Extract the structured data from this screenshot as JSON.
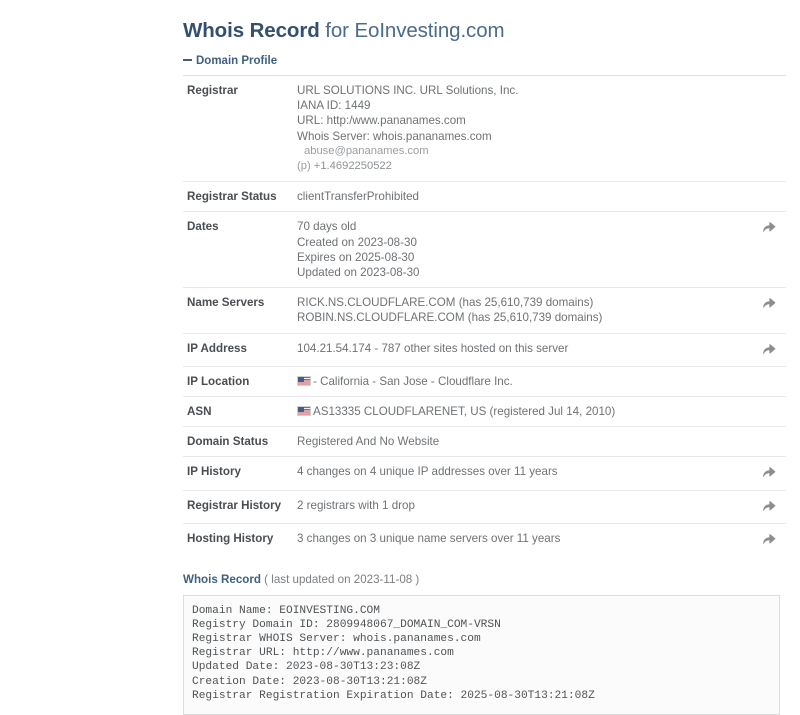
{
  "header": {
    "title_strong": "Whois Record",
    "title_rest": " for EoInvesting.com",
    "domain": "EoInvesting.com"
  },
  "section": {
    "toggle_label": "Domain Profile",
    "toggle_state": "expanded",
    "minus_glyph": "minus-icon"
  },
  "colors": {
    "title": "#34506e",
    "link": "#3f5f80",
    "label": "#4a4e52",
    "value": "#6e7275",
    "rule": "#e7e8ea",
    "box_border": "#dcdddf",
    "box_bg": "#fbfbfb"
  },
  "profile": {
    "rows": [
      {
        "label": "Registrar",
        "lines": [
          "URL SOLUTIONS INC. URL Solutions, Inc.",
          "IANA ID: 1449",
          "URL: http:/www.pananames.com",
          "Whois Server: whois.pananames.com"
        ],
        "email": "abuse@pananames.com",
        "phone_prefix": "(p)",
        "phone": "+1.4692250522",
        "has_action": false,
        "action_icon": ""
      },
      {
        "label": "Registrar Status",
        "lines": [
          "clientTransferProhibited"
        ],
        "has_action": false,
        "action_icon": ""
      },
      {
        "label": "Dates",
        "lines": [
          "70 days old",
          "Created on 2023-08-30",
          "Expires on 2025-08-30",
          "Updated on 2023-08-30"
        ],
        "has_action": true,
        "action_icon": "share-arrow-icon"
      },
      {
        "label": "Name Servers",
        "lines": [
          "RICK.NS.CLOUDFLARE.COM (has 25,610,739 domains)",
          "ROBIN.NS.CLOUDFLARE.COM (has 25,610,739 domains)"
        ],
        "has_action": true,
        "action_icon": "share-arrow-icon"
      },
      {
        "label": "IP Address",
        "lines": [
          "104.21.54.174 - 787 other sites hosted on this server"
        ],
        "has_action": true,
        "action_icon": "share-arrow-icon"
      },
      {
        "label": "IP Location",
        "flag": "us-flag-icon",
        "lines": [
          "- California - San Jose - Cloudflare Inc."
        ],
        "has_action": false,
        "action_icon": ""
      },
      {
        "label": "ASN",
        "flag": "us-flag-icon",
        "lines": [
          "AS13335 CLOUDFLARENET, US (registered Jul 14, 2010)"
        ],
        "has_action": false,
        "action_icon": ""
      },
      {
        "label": "Domain Status",
        "lines": [
          "Registered And No Website"
        ],
        "has_action": false,
        "action_icon": ""
      },
      {
        "label": "IP History",
        "lines": [
          "4 changes on 4 unique IP addresses over 11 years"
        ],
        "has_action": true,
        "action_icon": "share-arrow-icon"
      },
      {
        "label": "Registrar History",
        "lines": [
          "2 registrars with 1 drop"
        ],
        "has_action": true,
        "action_icon": "share-arrow-icon"
      },
      {
        "label": "Hosting History",
        "lines": [
          "3 changes on 3 unique name servers over 11 years"
        ],
        "has_action": true,
        "action_icon": "share-arrow-icon"
      }
    ]
  },
  "whois": {
    "heading": "Whois Record",
    "updated": " ( last updated on 2023-11-08 )",
    "raw": "Domain Name: EOINVESTING.COM\nRegistry Domain ID: 2809948067_DOMAIN_COM-VRSN\nRegistrar WHOIS Server: whois.pananames.com\nRegistrar URL: http://www.pananames.com\nUpdated Date: 2023-08-30T13:23:08Z\nCreation Date: 2023-08-30T13:21:08Z\nRegistrar Registration Expiration Date: 2025-08-30T13:21:08Z"
  }
}
